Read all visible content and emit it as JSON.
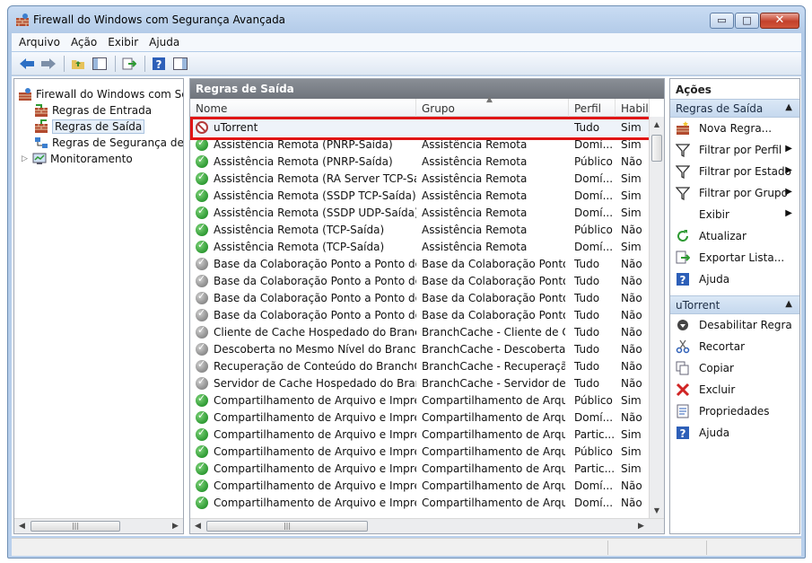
{
  "window": {
    "title": "Firewall do Windows com Segurança Avançada",
    "minimize_glyph": "▭",
    "maximize_glyph": "□",
    "close_glyph": "✕"
  },
  "menu": [
    "Arquivo",
    "Ação",
    "Exibir",
    "Ajuda"
  ],
  "tree": {
    "root": "Firewall do Windows com Segurança Avançada",
    "items": [
      "Regras de Entrada",
      "Regras de Saída",
      "Regras de Segurança de Conexão",
      "Monitoramento"
    ],
    "selected_index": 1
  },
  "center": {
    "title": "Regras de Saída",
    "columns": [
      "Nome",
      "Grupo",
      "Perfil",
      "Habilitado"
    ],
    "rows": [
      {
        "status": "block",
        "name": "uTorrent",
        "group": "",
        "profile": "Tudo",
        "enabled": "Sim"
      },
      {
        "status": "allow",
        "name": "Assistência Remota (PNRP-Saída)",
        "group": "Assistência Remota",
        "profile": "Domí...",
        "enabled": "Sim"
      },
      {
        "status": "allow",
        "name": "Assistência Remota (PNRP-Saída)",
        "group": "Assistência Remota",
        "profile": "Público",
        "enabled": "Não"
      },
      {
        "status": "allow",
        "name": "Assistência Remota (RA Server TCP-Saída)",
        "group": "Assistência Remota",
        "profile": "Domí...",
        "enabled": "Sim"
      },
      {
        "status": "allow",
        "name": "Assistência Remota (SSDP TCP-Saída)",
        "group": "Assistência Remota",
        "profile": "Domí...",
        "enabled": "Sim"
      },
      {
        "status": "allow",
        "name": "Assistência Remota (SSDP UDP-Saída)",
        "group": "Assistência Remota",
        "profile": "Domí...",
        "enabled": "Sim"
      },
      {
        "status": "allow",
        "name": "Assistência Remota (TCP-Saída)",
        "group": "Assistência Remota",
        "profile": "Público",
        "enabled": "Não"
      },
      {
        "status": "allow",
        "name": "Assistência Remota (TCP-Saída)",
        "group": "Assistência Remota",
        "profile": "Domí...",
        "enabled": "Sim"
      },
      {
        "status": "off",
        "name": "Base da Colaboração Ponto a Ponto do ...",
        "group": "Base da Colaboração Ponto ...",
        "profile": "Tudo",
        "enabled": "Não"
      },
      {
        "status": "off",
        "name": "Base da Colaboração Ponto a Ponto do ...",
        "group": "Base da Colaboração Ponto ...",
        "profile": "Tudo",
        "enabled": "Não"
      },
      {
        "status": "off",
        "name": "Base da Colaboração Ponto a Ponto do ...",
        "group": "Base da Colaboração Ponto ...",
        "profile": "Tudo",
        "enabled": "Não"
      },
      {
        "status": "off",
        "name": "Base da Colaboração Ponto a Ponto do ...",
        "group": "Base da Colaboração Ponto ...",
        "profile": "Tudo",
        "enabled": "Não"
      },
      {
        "status": "off",
        "name": "Cliente de Cache Hospedado do Branch...",
        "group": "BranchCache - Cliente de C...",
        "profile": "Tudo",
        "enabled": "Não"
      },
      {
        "status": "off",
        "name": "Descoberta no Mesmo Nível do BranchC...",
        "group": "BranchCache - Descoberta ...",
        "profile": "Tudo",
        "enabled": "Não"
      },
      {
        "status": "off",
        "name": "Recuperação de Conteúdo do BranchCac...",
        "group": "BranchCache - Recuperação...",
        "profile": "Tudo",
        "enabled": "Não"
      },
      {
        "status": "off",
        "name": "Servidor de Cache Hospedado do Branch...",
        "group": "BranchCache - Servidor de ...",
        "profile": "Tudo",
        "enabled": "Não"
      },
      {
        "status": "allow",
        "name": "Compartilhamento de Arquivo e Impress...",
        "group": "Compartilhamento de Arqui...",
        "profile": "Público",
        "enabled": "Sim"
      },
      {
        "status": "allow",
        "name": "Compartilhamento de Arquivo e Impress...",
        "group": "Compartilhamento de Arqui...",
        "profile": "Domí...",
        "enabled": "Não"
      },
      {
        "status": "allow",
        "name": "Compartilhamento de Arquivo e Impress...",
        "group": "Compartilhamento de Arqui...",
        "profile": "Partic...",
        "enabled": "Sim"
      },
      {
        "status": "allow",
        "name": "Compartilhamento de Arquivo e Impress...",
        "group": "Compartilhamento de Arqui...",
        "profile": "Público",
        "enabled": "Sim"
      },
      {
        "status": "allow",
        "name": "Compartilhamento de Arquivo e Impress...",
        "group": "Compartilhamento de Arqui...",
        "profile": "Partic...",
        "enabled": "Sim"
      },
      {
        "status": "allow",
        "name": "Compartilhamento de Arquivo e Impress...",
        "group": "Compartilhamento de Arqui...",
        "profile": "Domí...",
        "enabled": "Não"
      },
      {
        "status": "allow",
        "name": "Compartilhamento de Arquivo e Impress...",
        "group": "Compartilhamento de Arqui...",
        "profile": "Domí...",
        "enabled": "Não"
      }
    ]
  },
  "actions": {
    "title": "Ações",
    "section1": {
      "title": "Regras de Saída",
      "items": [
        {
          "icon": "new-rule-icon",
          "label": "Nova Regra...",
          "submenu": false
        },
        {
          "icon": "filter-icon",
          "label": "Filtrar por Perfil",
          "submenu": true
        },
        {
          "icon": "filter-icon",
          "label": "Filtrar por Estado",
          "submenu": true
        },
        {
          "icon": "filter-icon",
          "label": "Filtrar por Grupo",
          "submenu": true
        },
        {
          "icon": "",
          "label": "Exibir",
          "submenu": true
        },
        {
          "icon": "refresh-icon",
          "label": "Atualizar",
          "submenu": false
        },
        {
          "icon": "export-icon",
          "label": "Exportar Lista...",
          "submenu": false
        },
        {
          "icon": "help-icon",
          "label": "Ajuda",
          "submenu": false
        }
      ]
    },
    "section2": {
      "title": "uTorrent",
      "items": [
        {
          "icon": "disable-icon",
          "label": "Desabilitar Regra"
        },
        {
          "icon": "cut-icon",
          "label": "Recortar"
        },
        {
          "icon": "copy-icon",
          "label": "Copiar"
        },
        {
          "icon": "delete-icon",
          "label": "Excluir"
        },
        {
          "icon": "properties-icon",
          "label": "Propriedades"
        },
        {
          "icon": "help-icon",
          "label": "Ajuda"
        }
      ]
    }
  }
}
